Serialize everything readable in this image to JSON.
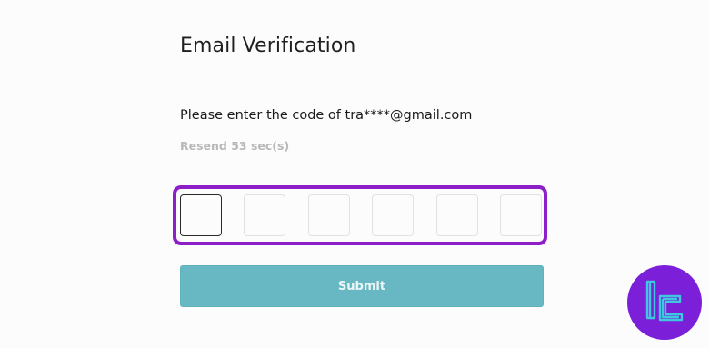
{
  "header": {
    "title": "Email Verification"
  },
  "verification": {
    "prompt": "Please enter the code of tra****@gmail.com",
    "resend": "Resend 53 sec(s)",
    "code_length": 6,
    "code_values": [
      "",
      "",
      "",
      "",
      "",
      ""
    ],
    "highlight_color": "#8d1fc9"
  },
  "actions": {
    "submit_label": "Submit",
    "submit_color": "#67b8c2"
  },
  "watermark": {
    "icon": "tc-logo-icon",
    "color": "#7b1fd8",
    "accent": "#3ec8e0"
  }
}
